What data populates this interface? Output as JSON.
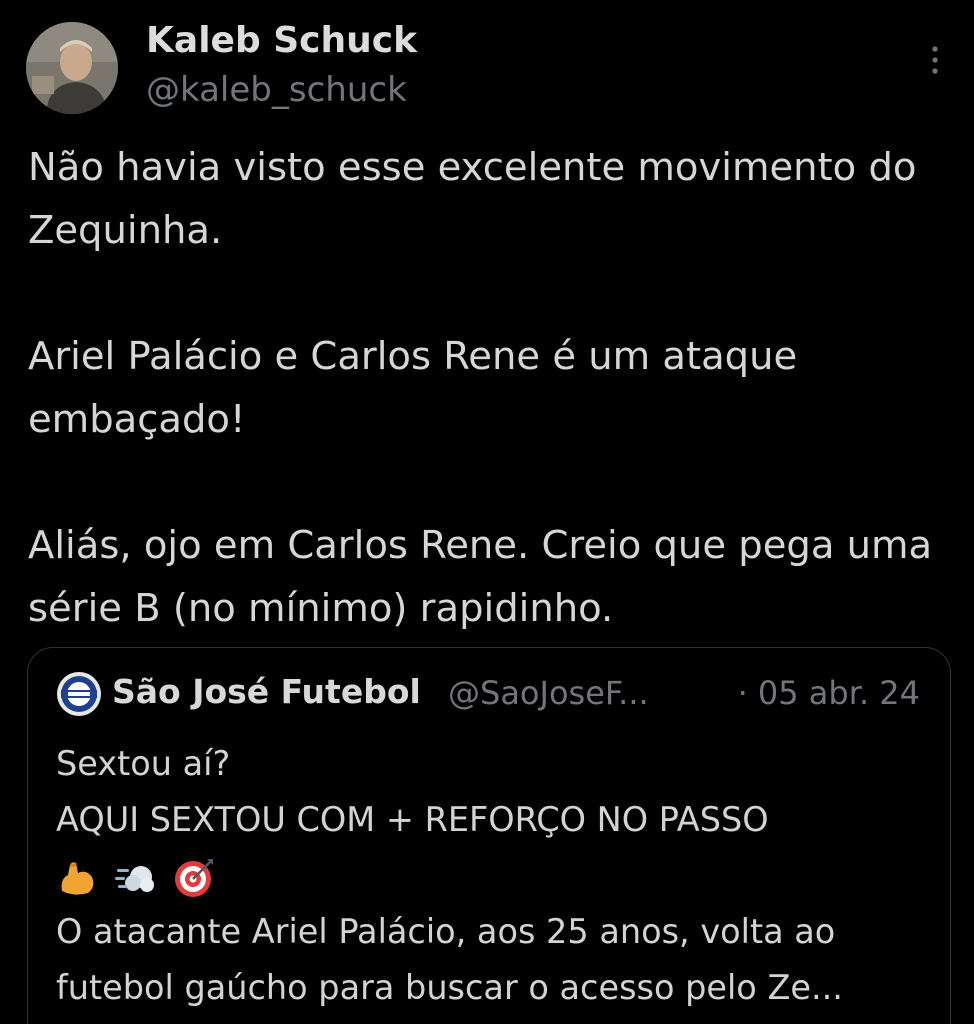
{
  "tweet": {
    "author": {
      "name": "Kaleb Schuck",
      "handle": "@kaleb_schuck"
    },
    "text": {
      "p1": "Não havia visto esse excelente movimento do Zequinha.",
      "p2": "Ariel Palácio e Carlos Rene é um ataque embaçado!",
      "p3": "Aliás, ojo em Carlos Rene. Creio que pega uma série B (no mínimo) rapidinho."
    },
    "more_icon": "more-vertical-icon"
  },
  "quoted_tweet": {
    "author": {
      "name": "São José Futebol",
      "handle": "@SaoJoseF...",
      "avatar_icon": "sao-jose-crest-icon"
    },
    "date": "· 05 abr. 24",
    "lines": {
      "l1": "Sextou aí?",
      "l2": "AQUI SEXTOU COM + REFORÇO NO PASSO",
      "l4": "O atacante Ariel Palácio, aos 25 anos, volta ao",
      "l5": "futebol gaúcho para buscar o acesso pelo Ze..."
    },
    "emojis": [
      "flexed-biceps-icon",
      "dashing-away-icon",
      "direct-hit-icon"
    ]
  },
  "colors": {
    "background": "#000000",
    "text": "#d6d6d6",
    "secondary": "#71767b",
    "border": "#2f3336"
  }
}
